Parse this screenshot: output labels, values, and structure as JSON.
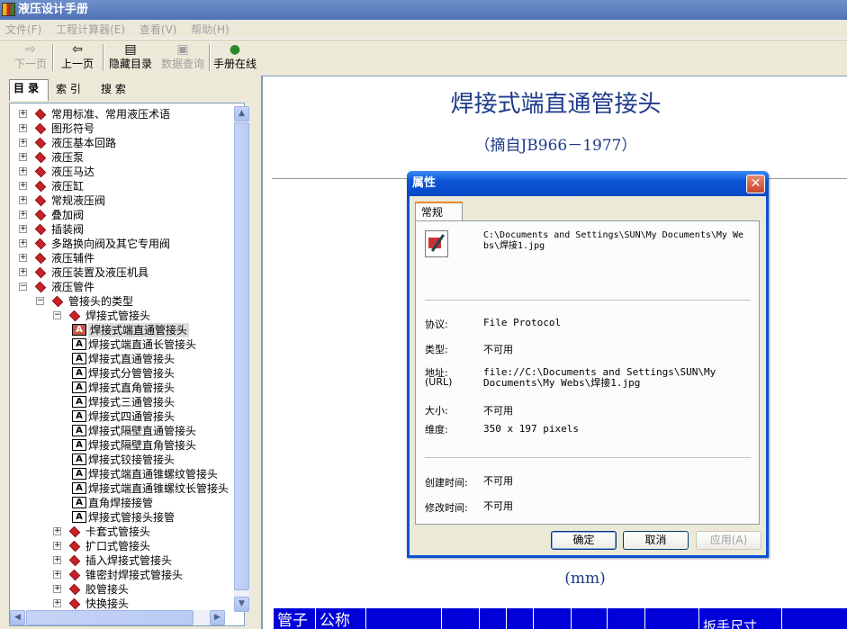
{
  "window": {
    "title": "液压设计手册"
  },
  "menu": [
    "文件(F)",
    "工程计算器(E)",
    "查看(V)",
    "帮助(H)"
  ],
  "toolbar": {
    "next": "下一页",
    "prev": "上一页",
    "hide_toc": "隐藏目录",
    "data_query": "数据查询",
    "online": "手册在线"
  },
  "left_tabs": [
    "目 录",
    "索 引",
    "搜 索"
  ],
  "tree": [
    "常用标准、常用液压术语",
    "图形符号",
    "液压基本回路",
    "液压泵",
    "液压马达",
    "液压缸",
    "常规液压阀",
    "叠加阀",
    "插装阀",
    "多路换向阀及其它专用阀",
    "液压辅件",
    "液压装置及液压机具",
    "液压管件",
    "管接头的类型",
    "焊接式管接头",
    "焊接式端直通管接头",
    "焊接式端直通长管接头",
    "焊接式直通管接头",
    "焊接式分管管接头",
    "焊接式直角管接头",
    "焊接式三通管接头",
    "焊接式四通管接头",
    "焊接式隔壁直通管接头",
    "焊接式隔壁直角管接头",
    "焊接式铰接管接头",
    "焊接式端直通锥螺纹管接头",
    "焊接式端直通锥螺纹长管接头",
    "直角焊接接管",
    "焊接式管接头接管",
    "卡套式管接头",
    "扩口式管接头",
    "插入焊接式管接头",
    "锥密封焊接式管接头",
    "胶管接头",
    "快换接头"
  ],
  "content": {
    "title": "焊接式端直通管接头",
    "subtitle": "（摘自JB966－1977）",
    "unit": "(mm)",
    "table_headers": [
      "管子",
      "公称",
      "扳手尺寸"
    ]
  },
  "dialog": {
    "title": "属性",
    "tab": "常规",
    "path": "C:\\Documents and Settings\\SUN\\My Documents\\My Webs\\焊接1.jpg",
    "protocol_label": "协议:",
    "protocol": "File Protocol",
    "type_label": "类型:",
    "type": "不可用",
    "address_label": "地址:",
    "address_label2": "(URL)",
    "address": "file://C:\\Documents and Settings\\SUN\\My Documents\\My Webs\\焊接1.jpg",
    "size_label": "大小:",
    "size": "不可用",
    "dims_label": "维度:",
    "dims": "350 x 197 pixels",
    "created_label": "创建时间:",
    "created": "不可用",
    "modified_label": "修改时间:",
    "modified": "不可用",
    "ok": "确定",
    "cancel": "取消",
    "apply": "应用(A)"
  }
}
